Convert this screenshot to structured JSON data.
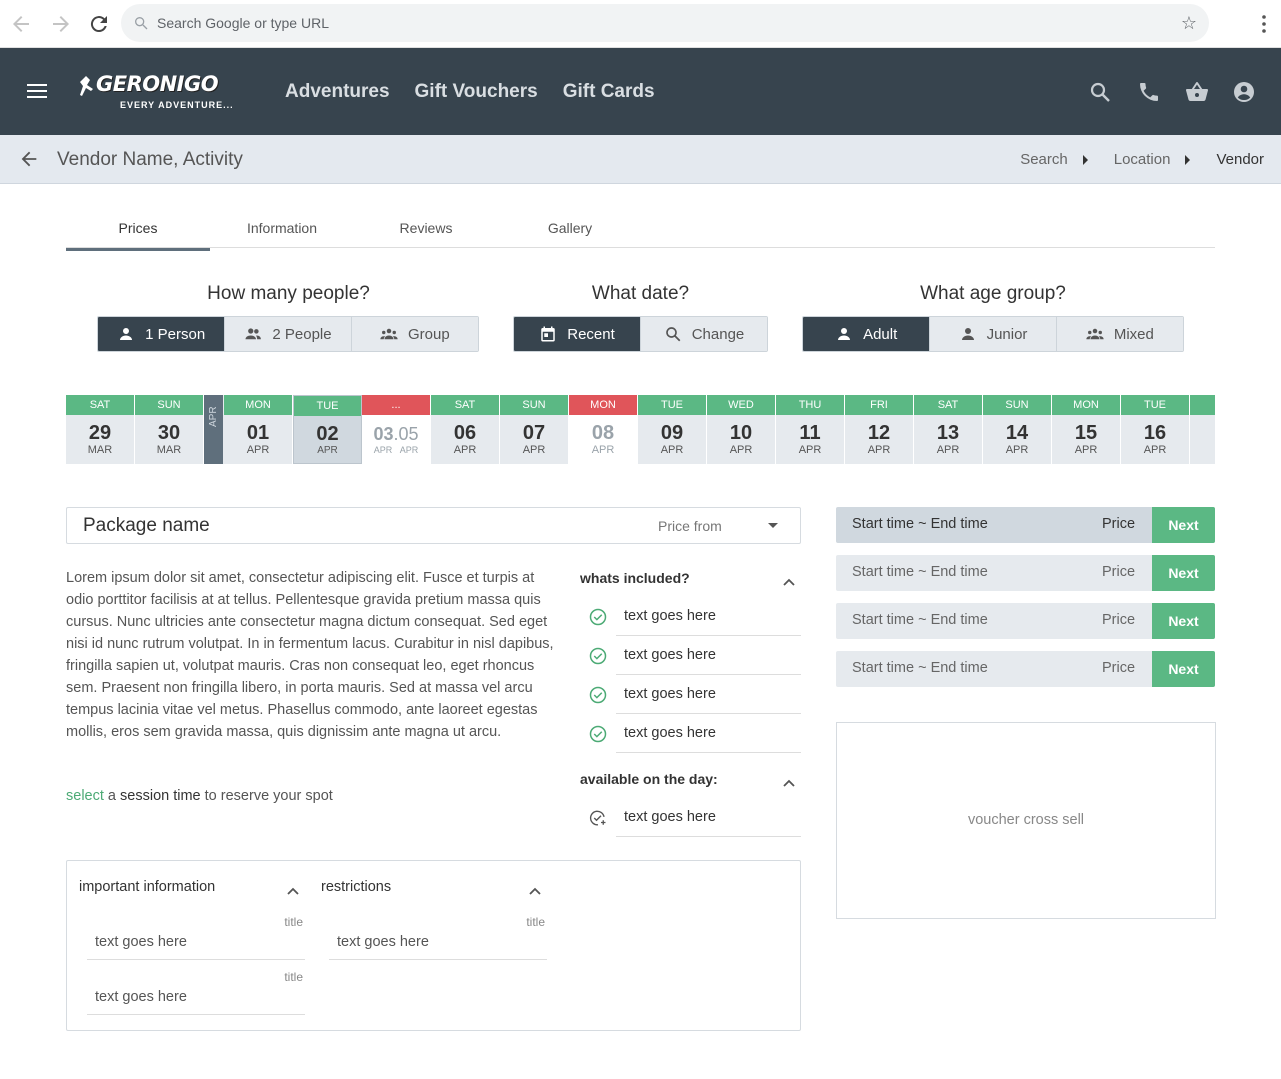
{
  "browser": {
    "omnibox_placeholder": "Search Google or type URL"
  },
  "header": {
    "logo_text": "GERONIGO",
    "logo_tagline": "EVERY ADVENTURE...",
    "nav": [
      "Adventures",
      "Gift Vouchers",
      "Gift Cards"
    ]
  },
  "breadcrumb": {
    "title": "Vendor Name, Activity",
    "items": [
      "Search",
      "Location",
      "Vendor"
    ]
  },
  "tabs": [
    "Prices",
    "Information",
    "Reviews",
    "Gallery"
  ],
  "people": {
    "title": "How many people?",
    "options": [
      "1 Person",
      "2 People",
      "Group"
    ],
    "selected": "1 Person"
  },
  "date": {
    "title": "What date?",
    "options": [
      "Recent",
      "Change"
    ],
    "selected": "Recent"
  },
  "age": {
    "title": "What age group?",
    "options": [
      "Adult",
      "Junior",
      "Mixed"
    ],
    "selected": "Adult"
  },
  "date_strip": {
    "month_label": "APR",
    "days": [
      {
        "dow": "SAT",
        "num": "29",
        "mon": "MAR"
      },
      {
        "dow": "SUN",
        "num": "30",
        "mon": "MAR"
      },
      {
        "dow": "MON",
        "num": "01",
        "mon": "APR"
      },
      {
        "dow": "TUE",
        "num": "02",
        "mon": "APR"
      },
      {
        "dow": "...",
        "num": "03",
        "num2": "05",
        "mon": "APR",
        "mon2": "APR"
      },
      {
        "dow": "SAT",
        "num": "06",
        "mon": "APR"
      },
      {
        "dow": "SUN",
        "num": "07",
        "mon": "APR"
      },
      {
        "dow": "MON",
        "num": "08",
        "mon": "APR"
      },
      {
        "dow": "TUE",
        "num": "09",
        "mon": "APR"
      },
      {
        "dow": "WED",
        "num": "10",
        "mon": "APR"
      },
      {
        "dow": "THU",
        "num": "11",
        "mon": "APR"
      },
      {
        "dow": "FRI",
        "num": "12",
        "mon": "APR"
      },
      {
        "dow": "SAT",
        "num": "13",
        "mon": "APR"
      },
      {
        "dow": "SUN",
        "num": "14",
        "mon": "APR"
      },
      {
        "dow": "MON",
        "num": "15",
        "mon": "APR"
      },
      {
        "dow": "TUE",
        "num": "16",
        "mon": "APR"
      }
    ],
    "colors": {
      "available": "#5bb884",
      "unavailable": "#e0555a"
    }
  },
  "package": {
    "name": "Package name",
    "price_from": "Price from",
    "description": "Lorem ipsum dolor sit amet, consectetur adipiscing elit. Fusce et turpis at odio porttitor facilisis at at tellus. Pellentesque gravida pretium massa quis cursus. Nunc ultricies ante consectetur magna dictum consequat. Sed eget nisi id nunc rutrum volutpat. In in fermentum lacus. Curabitur in nisl dapibus, fringilla sapien ut, volutpat mauris. Cras non consequat leo, eget rhoncus sem. Praesent non fringilla libero, in porta mauris. Sed at massa vel arcu tempus lacinia vitae vel metus. Phasellus commodo, ante laoreet egestas mollis, eros sem gravida massa, quis dignissim ante magna ut arcu.",
    "cta_select": "select",
    "cta_a": "a",
    "cta_session": "session time",
    "cta_rest": "to reserve your spot"
  },
  "included": {
    "title": "whats included?",
    "items": [
      "text goes here",
      "text goes here",
      "text goes here",
      "text goes here"
    ]
  },
  "on_the_day": {
    "title": "available on the day:",
    "items": [
      "text goes here"
    ]
  },
  "important": {
    "title": "important information",
    "fields": [
      {
        "label": "title",
        "value": "text goes here"
      },
      {
        "label": "title",
        "value": "text goes here"
      }
    ]
  },
  "restrictions": {
    "title": "restrictions",
    "fields": [
      {
        "label": "title",
        "value": "text goes here"
      }
    ]
  },
  "sessions": [
    {
      "time": "Start time ~ End time",
      "price": "Price",
      "action": "Next"
    },
    {
      "time": "Start time ~ End time",
      "price": "Price",
      "action": "Next"
    },
    {
      "time": "Start time ~ End time",
      "price": "Price",
      "action": "Next"
    },
    {
      "time": "Start time ~ End time",
      "price": "Price",
      "action": "Next"
    }
  ],
  "voucher": "voucher cross sell",
  "colors": {
    "header": "#37444e",
    "accent": "#5bb884",
    "alert": "#e0555a"
  }
}
